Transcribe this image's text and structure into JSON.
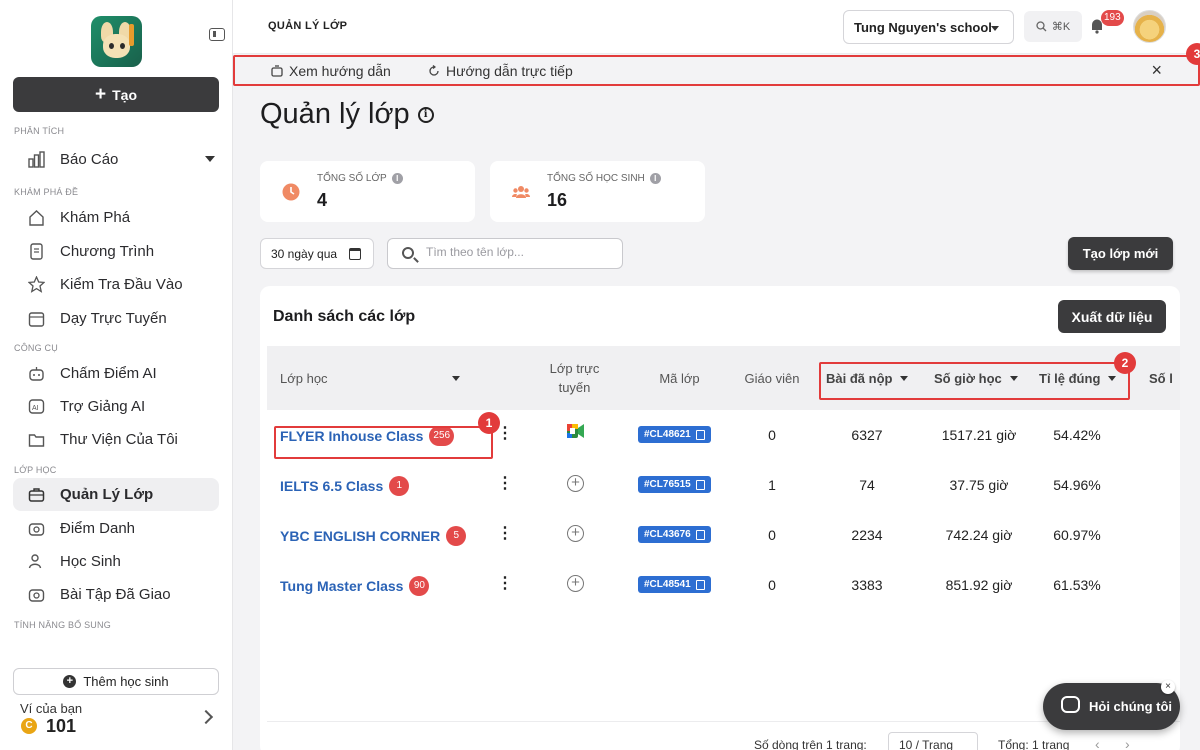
{
  "sidebar": {
    "create_label": "Tạo",
    "sections": {
      "analysis": "PHÂN TÍCH",
      "explore": "KHÁM PHÁ ĐỀ",
      "tools": "CÔNG CỤ",
      "classes": "LỚP HỌC",
      "extra": "TÍNH NĂNG BỔ SUNG"
    },
    "items": [
      {
        "label": "Báo Cáo",
        "icon": "bar-chart-icon"
      },
      {
        "label": "Khám Phá",
        "icon": "home-icon"
      },
      {
        "label": "Chương Trình",
        "icon": "document-icon"
      },
      {
        "label": "Kiểm Tra Đầu Vào",
        "icon": "star-icon"
      },
      {
        "label": "Dạy Trực Tuyến",
        "icon": "calendar-icon"
      },
      {
        "label": "Chấm Điểm AI",
        "icon": "robot-icon"
      },
      {
        "label": "Trợ Giảng AI",
        "icon": "ai-icon"
      },
      {
        "label": "Thư Viện Của Tôi",
        "icon": "folder-icon"
      },
      {
        "label": "Quản Lý Lớp",
        "icon": "briefcase-icon"
      },
      {
        "label": "Điểm Danh",
        "icon": "camera-icon"
      },
      {
        "label": "Học Sinh",
        "icon": "users-icon"
      },
      {
        "label": "Bài Tập Đã Giao",
        "icon": "camera-icon"
      }
    ],
    "add_student": "Thêm học sinh",
    "wallet_label": "Ví của bạn",
    "wallet_coin": "C",
    "wallet_value": "101"
  },
  "topbar": {
    "title": "QUẢN LÝ LỚP",
    "school": "Tung Nguyen's school",
    "search_shortcut": "⌘K",
    "notifications": "193"
  },
  "guide": {
    "watch_label": "Xem hướng dẫn",
    "live_label": "Hướng dẫn trực tiếp",
    "close": "×",
    "marker": "3"
  },
  "main": {
    "page_title": "Quản lý lớp",
    "stats": [
      {
        "label": "TỔNG SỐ LỚP",
        "value": "4"
      },
      {
        "label": "TỔNG SỐ HỌC SINH",
        "value": "16"
      }
    ],
    "date_filter": "30 ngày qua",
    "search_placeholder": "Tìm theo tên lớp...",
    "new_class": "Tạo lớp mới",
    "panel_title": "Danh sách các lớp",
    "export": "Xuất dữ liệu",
    "columns": {
      "class": "Lớp học",
      "online": "Lớp trực tuyến",
      "code": "Mã lớp",
      "teacher": "Giáo viên",
      "submitted": "Bài đã nộp",
      "hours": "Số giờ học",
      "accuracy": "Tỉ lệ đúng",
      "more": "Số l"
    },
    "markers": {
      "one": "1",
      "two": "2"
    },
    "rows": [
      {
        "name": "FLYER Inhouse Class",
        "badge": "256",
        "code": "#CL48621",
        "teacher": "0",
        "submitted": "6327",
        "hours": "1517.21 giờ",
        "accuracy": "54.42%"
      },
      {
        "name": "IELTS 6.5 Class",
        "badge": "1",
        "code": "#CL76515",
        "teacher": "1",
        "submitted": "74",
        "hours": "37.75 giờ",
        "accuracy": "54.96%"
      },
      {
        "name": "YBC ENGLISH CORNER",
        "badge": "5",
        "code": "#CL43676",
        "teacher": "0",
        "submitted": "2234",
        "hours": "742.24 giờ",
        "accuracy": "60.97%"
      },
      {
        "name": "Tung Master Class",
        "badge": "90",
        "code": "#CL48541",
        "teacher": "0",
        "submitted": "3383",
        "hours": "851.92 giờ",
        "accuracy": "61.53%"
      }
    ],
    "pager": {
      "rows_per_page_label": "Số dòng trên 1 trang:",
      "rows_per_page": "10 / Trang",
      "total": "Tổng: 1 trang"
    }
  },
  "chat": {
    "label": "Hỏi chúng tôi",
    "close": "×"
  },
  "colors": {
    "accent_dark": "#3b3b3d",
    "highlight_red": "#e23b3b",
    "link_blue": "#2b63b6",
    "code_blue": "#2d6ed2"
  }
}
